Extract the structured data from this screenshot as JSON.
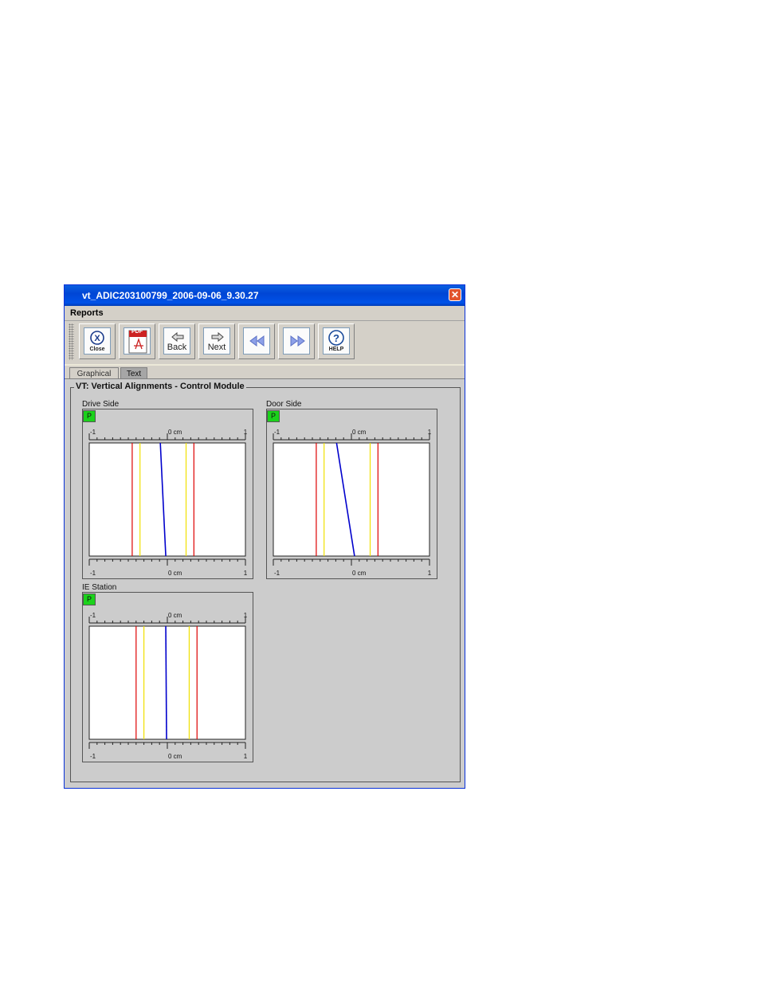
{
  "window": {
    "title": "vt_ADIC203100799_2006-09-06_9.30.27",
    "close_glyph": "✕"
  },
  "menu": {
    "reports": "Reports"
  },
  "toolbar": {
    "close_label": "Close",
    "pdf_text": "PDF",
    "back_label": "Back",
    "next_label": "Next",
    "help_label": "HELP",
    "icons": [
      "close-icon",
      "pdf-icon",
      "back-arrow-icon",
      "next-arrow-icon",
      "rewind-icon",
      "fast-forward-icon",
      "help-icon"
    ]
  },
  "tabs": {
    "graphical": "Graphical",
    "text": "Text"
  },
  "report": {
    "title": "VT: Vertical Alignments - Control Module",
    "status_colors": {
      "pass": "#1bd21b",
      "limit_outer": "#dd0000",
      "limit_inner": "#f0e000",
      "measurement": "#0000cc"
    }
  },
  "chart_data": [
    {
      "type": "line",
      "title": "Drive Side",
      "status": "P",
      "x_ticks_top": [
        "-1",
        "0 cm",
        "1"
      ],
      "x_ticks_bottom": [
        "-1",
        "0 cm",
        "1"
      ],
      "xlim": [
        -1,
        1
      ],
      "limits_outer": [
        -0.45,
        0.34
      ],
      "limits_inner": [
        -0.35,
        0.24
      ],
      "measurement": {
        "top": -0.09,
        "bottom": -0.02
      }
    },
    {
      "type": "line",
      "title": "Door Side",
      "status": "P",
      "x_ticks_top": [
        "-1",
        "0 cm",
        "1"
      ],
      "x_ticks_bottom": [
        "-1",
        "0 cm",
        "1"
      ],
      "xlim": [
        -1,
        1
      ],
      "limits_outer": [
        -0.45,
        0.34
      ],
      "limits_inner": [
        -0.35,
        0.24
      ],
      "measurement": {
        "top": -0.19,
        "bottom": 0.04
      }
    },
    {
      "type": "line",
      "title": "IE Station",
      "status": "P",
      "x_ticks_top": [
        "-1",
        "0 cm",
        "1"
      ],
      "x_ticks_bottom": [
        "-1",
        "0 cm",
        "1"
      ],
      "xlim": [
        -1,
        1
      ],
      "limits_outer": [
        -0.4,
        0.38
      ],
      "limits_inner": [
        -0.3,
        0.28
      ],
      "measurement": {
        "top": -0.02,
        "bottom": -0.01
      }
    }
  ]
}
